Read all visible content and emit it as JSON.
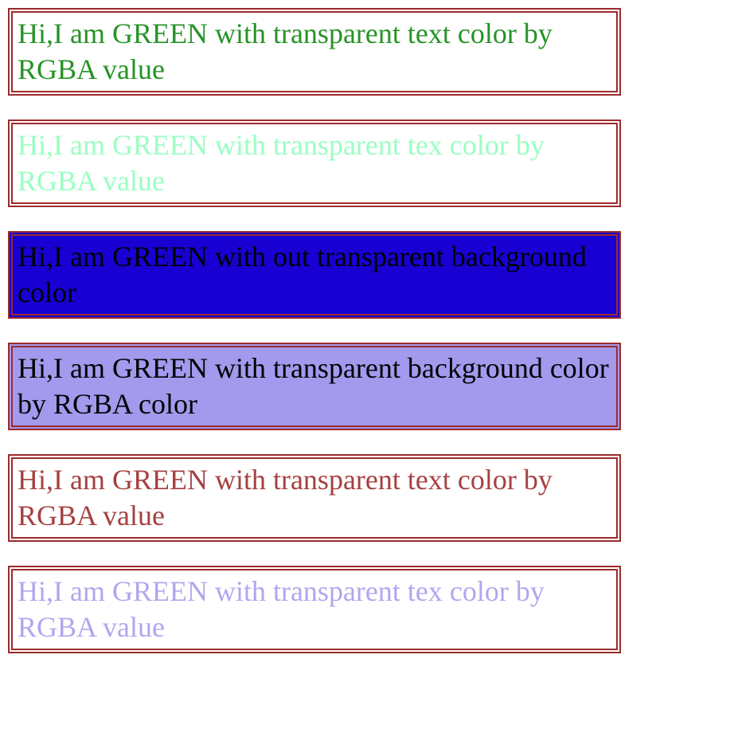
{
  "boxes": {
    "b1": "Hi,I am GREEN with transparent text color by RGBA value",
    "b2": "Hi,I am GREEN with transparent tex color by RGBA value",
    "b3": "Hi,I am GREEN with out transparent background color",
    "b4": "Hi,I am GREEN with transparent background color by RGBA color",
    "b5": "Hi,I am GREEN with transparent text color by RGBA value",
    "b6": "Hi,I am GREEN with transparent tex color by RGBA value"
  },
  "colors": {
    "border": "#9c2b2b",
    "green_solid": "rgba(0,128,0,0.85)",
    "green_light": "rgba(0,255,100,0.4)",
    "blue_solid": "rgb(25,0,210)",
    "blue_transparent": "rgba(25,0,210,0.4)",
    "red_text": "rgba(156,43,43,0.9)",
    "blue_text_transparent": "rgba(25,0,210,0.35)"
  }
}
